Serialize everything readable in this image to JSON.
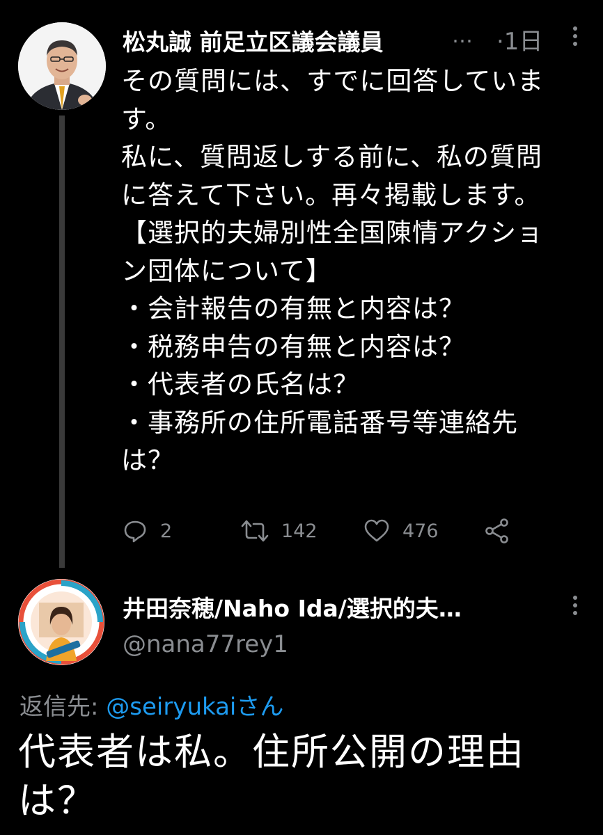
{
  "tweet1": {
    "display_name": "松丸誠 前足立区議会議員",
    "name_ellipsis": "…",
    "time": "·1日",
    "body_lines": [
      "その質問には、すでに回答していま",
      "す。",
      "私に、質問返しする前に、私の質問",
      "に答えて下さい。再々掲載します。",
      "【選択的夫婦別性全国陳情アクショ",
      "ン団体について】",
      "・会計報告の有無と内容は？",
      "・税務申告の有無と内容は？",
      "・代表者の氏名は？",
      "・事務所の住所電話番号等連絡先",
      "は？"
    ],
    "replies": "2",
    "retweets": "142",
    "likes": "476"
  },
  "tweet2": {
    "display_name": "井田奈穂/Naho Ida/選択的夫…",
    "handle": "@nana77rey1",
    "reply_prefix": "返信先: ",
    "reply_mention": "@seiryukaiさん",
    "body_lines": [
      "代表者は私。住所公開の理由",
      "は？"
    ]
  },
  "colors": {
    "background": "#000000",
    "text": "#ffffff",
    "secondary": "#8a8d91",
    "link": "#1d9bf0",
    "thread_line": "#3a3a3a"
  },
  "icons": [
    "more-vertical-icon",
    "reply-icon",
    "retweet-icon",
    "like-icon",
    "share-icon"
  ]
}
